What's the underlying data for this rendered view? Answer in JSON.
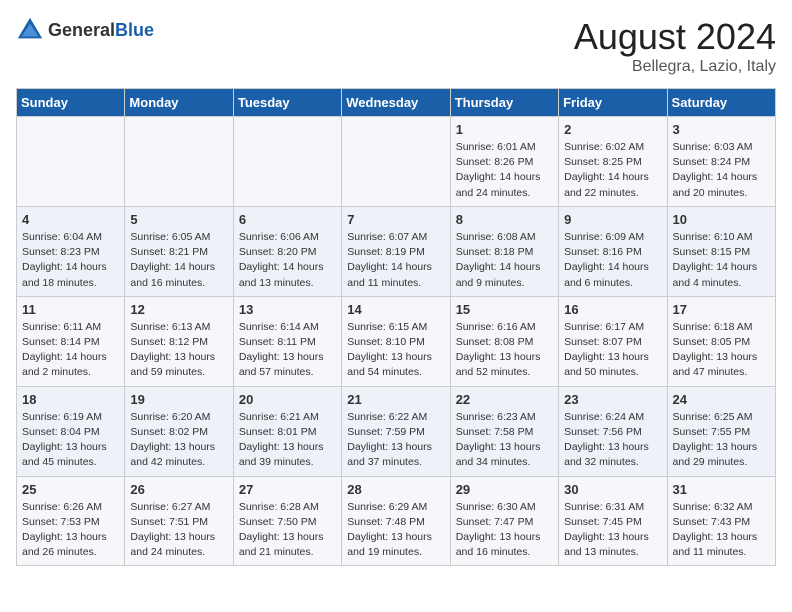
{
  "logo": {
    "general": "General",
    "blue": "Blue"
  },
  "title": "August 2024",
  "subtitle": "Bellegra, Lazio, Italy",
  "days_of_week": [
    "Sunday",
    "Monday",
    "Tuesday",
    "Wednesday",
    "Thursday",
    "Friday",
    "Saturday"
  ],
  "weeks": [
    [
      {
        "day": "",
        "content": ""
      },
      {
        "day": "",
        "content": ""
      },
      {
        "day": "",
        "content": ""
      },
      {
        "day": "",
        "content": ""
      },
      {
        "day": "1",
        "content": "Sunrise: 6:01 AM\nSunset: 8:26 PM\nDaylight: 14 hours\nand 24 minutes."
      },
      {
        "day": "2",
        "content": "Sunrise: 6:02 AM\nSunset: 8:25 PM\nDaylight: 14 hours\nand 22 minutes."
      },
      {
        "day": "3",
        "content": "Sunrise: 6:03 AM\nSunset: 8:24 PM\nDaylight: 14 hours\nand 20 minutes."
      }
    ],
    [
      {
        "day": "4",
        "content": "Sunrise: 6:04 AM\nSunset: 8:23 PM\nDaylight: 14 hours\nand 18 minutes."
      },
      {
        "day": "5",
        "content": "Sunrise: 6:05 AM\nSunset: 8:21 PM\nDaylight: 14 hours\nand 16 minutes."
      },
      {
        "day": "6",
        "content": "Sunrise: 6:06 AM\nSunset: 8:20 PM\nDaylight: 14 hours\nand 13 minutes."
      },
      {
        "day": "7",
        "content": "Sunrise: 6:07 AM\nSunset: 8:19 PM\nDaylight: 14 hours\nand 11 minutes."
      },
      {
        "day": "8",
        "content": "Sunrise: 6:08 AM\nSunset: 8:18 PM\nDaylight: 14 hours\nand 9 minutes."
      },
      {
        "day": "9",
        "content": "Sunrise: 6:09 AM\nSunset: 8:16 PM\nDaylight: 14 hours\nand 6 minutes."
      },
      {
        "day": "10",
        "content": "Sunrise: 6:10 AM\nSunset: 8:15 PM\nDaylight: 14 hours\nand 4 minutes."
      }
    ],
    [
      {
        "day": "11",
        "content": "Sunrise: 6:11 AM\nSunset: 8:14 PM\nDaylight: 14 hours\nand 2 minutes."
      },
      {
        "day": "12",
        "content": "Sunrise: 6:13 AM\nSunset: 8:12 PM\nDaylight: 13 hours\nand 59 minutes."
      },
      {
        "day": "13",
        "content": "Sunrise: 6:14 AM\nSunset: 8:11 PM\nDaylight: 13 hours\nand 57 minutes."
      },
      {
        "day": "14",
        "content": "Sunrise: 6:15 AM\nSunset: 8:10 PM\nDaylight: 13 hours\nand 54 minutes."
      },
      {
        "day": "15",
        "content": "Sunrise: 6:16 AM\nSunset: 8:08 PM\nDaylight: 13 hours\nand 52 minutes."
      },
      {
        "day": "16",
        "content": "Sunrise: 6:17 AM\nSunset: 8:07 PM\nDaylight: 13 hours\nand 50 minutes."
      },
      {
        "day": "17",
        "content": "Sunrise: 6:18 AM\nSunset: 8:05 PM\nDaylight: 13 hours\nand 47 minutes."
      }
    ],
    [
      {
        "day": "18",
        "content": "Sunrise: 6:19 AM\nSunset: 8:04 PM\nDaylight: 13 hours\nand 45 minutes."
      },
      {
        "day": "19",
        "content": "Sunrise: 6:20 AM\nSunset: 8:02 PM\nDaylight: 13 hours\nand 42 minutes."
      },
      {
        "day": "20",
        "content": "Sunrise: 6:21 AM\nSunset: 8:01 PM\nDaylight: 13 hours\nand 39 minutes."
      },
      {
        "day": "21",
        "content": "Sunrise: 6:22 AM\nSunset: 7:59 PM\nDaylight: 13 hours\nand 37 minutes."
      },
      {
        "day": "22",
        "content": "Sunrise: 6:23 AM\nSunset: 7:58 PM\nDaylight: 13 hours\nand 34 minutes."
      },
      {
        "day": "23",
        "content": "Sunrise: 6:24 AM\nSunset: 7:56 PM\nDaylight: 13 hours\nand 32 minutes."
      },
      {
        "day": "24",
        "content": "Sunrise: 6:25 AM\nSunset: 7:55 PM\nDaylight: 13 hours\nand 29 minutes."
      }
    ],
    [
      {
        "day": "25",
        "content": "Sunrise: 6:26 AM\nSunset: 7:53 PM\nDaylight: 13 hours\nand 26 minutes."
      },
      {
        "day": "26",
        "content": "Sunrise: 6:27 AM\nSunset: 7:51 PM\nDaylight: 13 hours\nand 24 minutes."
      },
      {
        "day": "27",
        "content": "Sunrise: 6:28 AM\nSunset: 7:50 PM\nDaylight: 13 hours\nand 21 minutes."
      },
      {
        "day": "28",
        "content": "Sunrise: 6:29 AM\nSunset: 7:48 PM\nDaylight: 13 hours\nand 19 minutes."
      },
      {
        "day": "29",
        "content": "Sunrise: 6:30 AM\nSunset: 7:47 PM\nDaylight: 13 hours\nand 16 minutes."
      },
      {
        "day": "30",
        "content": "Sunrise: 6:31 AM\nSunset: 7:45 PM\nDaylight: 13 hours\nand 13 minutes."
      },
      {
        "day": "31",
        "content": "Sunrise: 6:32 AM\nSunset: 7:43 PM\nDaylight: 13 hours\nand 11 minutes."
      }
    ]
  ]
}
